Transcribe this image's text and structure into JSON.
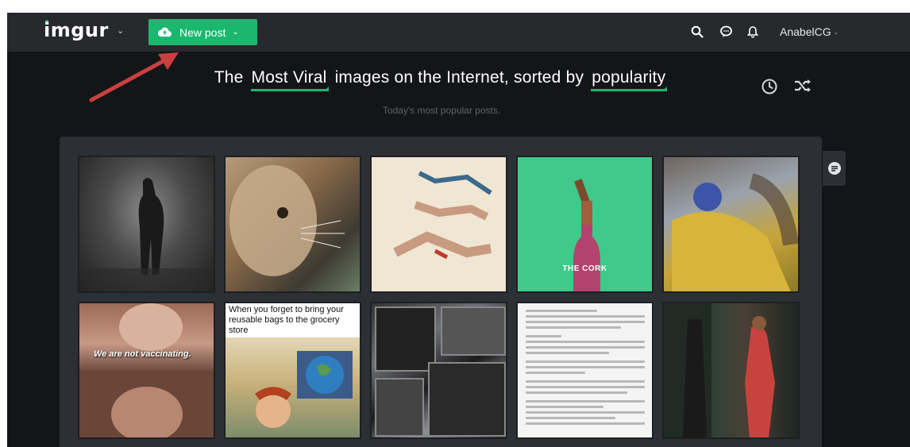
{
  "header": {
    "logo_text": "imgur",
    "new_post_label": "New post",
    "username": "AnabelCG",
    "icons": [
      "search-icon",
      "chat-icon",
      "bell-icon"
    ]
  },
  "headline": {
    "prefix": "The",
    "section": "Most Viral",
    "middle": "images on the Internet, sorted by",
    "sort": "popularity"
  },
  "subheadline": "Today's most popular posts.",
  "gallery": {
    "captions": {
      "post6": "We are not vaccinating.",
      "post7": "When you forget to bring your reusable bags to the grocery store",
      "post4": "THE CORK"
    }
  },
  "colors": {
    "accent": "#1bb76e",
    "topbar": "#27292d",
    "background": "#141518",
    "panel": "#2c2f34",
    "annotation_arrow": "#c9403f"
  }
}
